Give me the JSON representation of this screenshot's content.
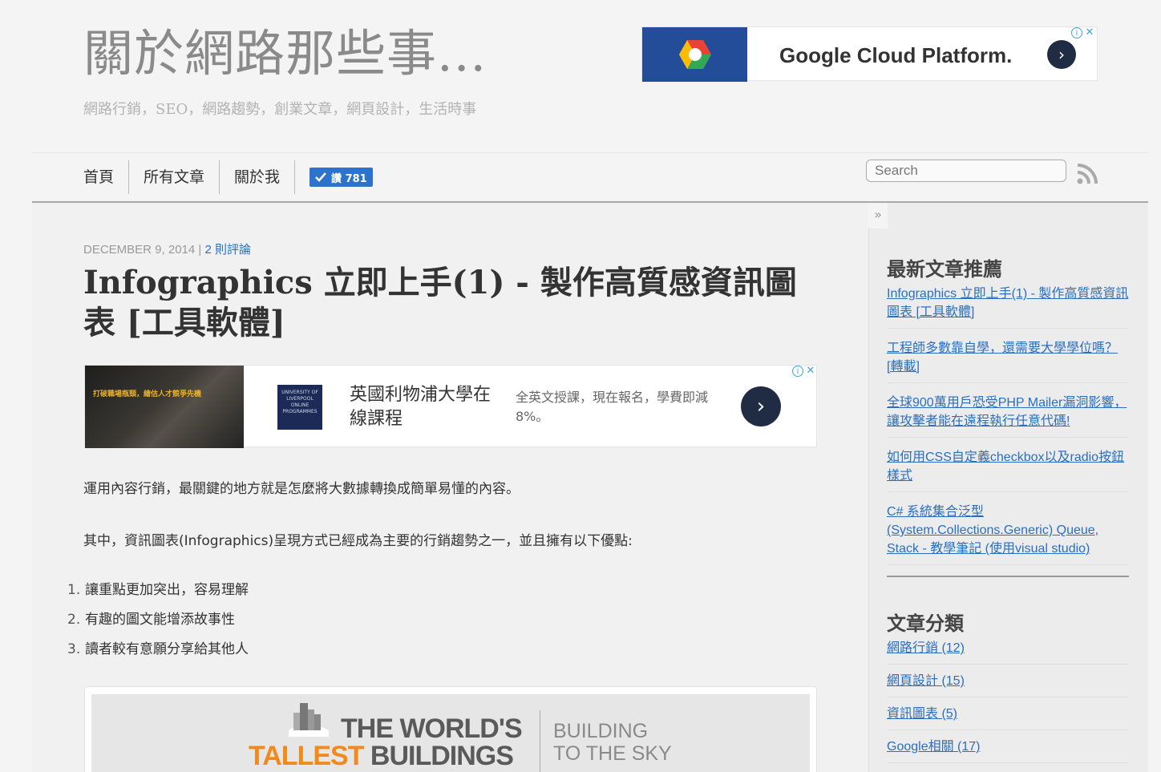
{
  "site": {
    "title": "關於網路那些事...",
    "tagline": "網路行銷，SEO，網路趨勢，創業文章，網頁設計，生活時事"
  },
  "top_ad": {
    "text": "Google Cloud Platform.",
    "arrow": "›",
    "info": "i",
    "close": "✕"
  },
  "nav": {
    "items": [
      {
        "label": "首頁"
      },
      {
        "label": "所有文章"
      },
      {
        "label": "關於我"
      }
    ],
    "like_label": "讚 781",
    "search_placeholder": "Search"
  },
  "sidebar_toggle": "»",
  "post": {
    "date": "DECEMBER 9, 2014",
    "separator": " | ",
    "comments": "2 則評論",
    "title": "Infographics 立即上手(1) - 製作高質感資訊圖表 [工具軟體]",
    "para1": "運用內容行銷，最關鍵的地方就是怎麼將大數據轉換成簡單易懂的內容。",
    "para2": "其中，資訊圖表(Infographics)呈現方式已經成為主要的行銷趨勢之一，並且擁有以下優點:",
    "list": [
      {
        "num": "1.",
        "text": "讓重點更加突出，容易理解"
      },
      {
        "num": "2.",
        "text": "有趣的圖文能增添故事性"
      },
      {
        "num": "3.",
        "text": "讀者較有意願分享給其他人"
      }
    ]
  },
  "mid_ad": {
    "photo_text": "打破職場瓶頸，繪估人才競爭先機",
    "crest_text": "UNIVERSITY OF LIVERPOOL ONLINE PROGRAMMES",
    "headline": "英國利物浦大學在線課程",
    "desc": "全英文授課，現在報名，學費即減8%。",
    "arrow": "›",
    "info": "i",
    "close": "✕"
  },
  "infographic": {
    "line1": "THE WORLD'S",
    "line2_a": "TALLEST ",
    "line2_b": "BUILDINGS",
    "sub1": "BUILDING",
    "sub2": "TO THE SKY"
  },
  "sidebar": {
    "recent_heading": "最新文章推薦",
    "recent": [
      {
        "label": "Infographics 立即上手(1) - 製作高質感資訊圖表 [工具軟體]"
      },
      {
        "label": "工程師多數靠自學，還需要大學學位嗎？[轉載]"
      },
      {
        "label": "全球900萬用戶恐受PHP Mailer漏洞影響，讓攻擊者能在遠程執行任意代碼!"
      },
      {
        "label": "如何用CSS自定義checkbox以及radio按鈕樣式"
      },
      {
        "label": "C# 系統集合泛型(System.Collections.Generic) Queue, Stack - 教學筆記 (使用visual studio)"
      }
    ],
    "categories_heading": "文章分類",
    "categories": [
      {
        "label": "網路行銷 (12)"
      },
      {
        "label": "網頁設計 (15)"
      },
      {
        "label": "資訊圖表 (5)"
      },
      {
        "label": "Google相關 (17)"
      }
    ]
  },
  "colors": {
    "link": "#2a6fbf",
    "like_button": "#2d73cc",
    "ad_blue": "#234c99",
    "orange": "#f18a1c"
  }
}
